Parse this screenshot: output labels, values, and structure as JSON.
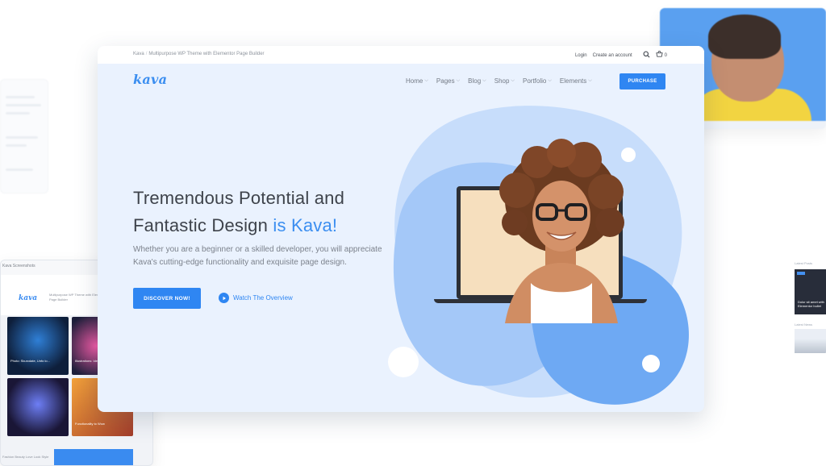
{
  "window": {
    "breadcrumb": {
      "site": "Kava",
      "separator": "/",
      "page": "Multipurpose WP Theme with Elementor Page Builder"
    },
    "topbar": {
      "login": "Login",
      "create_account": "Create an account",
      "cart_count": "0"
    },
    "logo": "kava",
    "menu": [
      {
        "label": "Home"
      },
      {
        "label": "Pages"
      },
      {
        "label": "Blog"
      },
      {
        "label": "Shop"
      },
      {
        "label": "Portfolio"
      },
      {
        "label": "Elements"
      }
    ],
    "purchase_label": "PURCHASE",
    "hero": {
      "title_line1": "Tremendous Potential and",
      "title_line2_prefix": "Fantastic Design ",
      "title_line2_accent": "is Kava!",
      "subtitle": "Whether you are a beginner or a skilled developer, you will appreciate Kava's cutting-edge functionality and exquisite page design.",
      "discover_label": "DISCOVER NOW!",
      "watch_label": "Watch The Overview"
    }
  },
  "background_cards": {
    "left_bottom": {
      "title": "Kava Screenshots",
      "logo": "kava",
      "text": "Multipurpose WP Theme with Elementor Page Builder",
      "captions": [
        "Photo: Skurcdate, Unfo lo...",
        "Illustrations: Ideas to...",
        "Functionality to Wow"
      ],
      "footer": "Fashion  Beauty  Love  Look  Style"
    },
    "right_mid": {
      "label_top": "Latest Posts",
      "label_bottom": "Latest News",
      "caption": "Dolor sit amet with Elementor bullet"
    }
  },
  "colors": {
    "accent": "#2f86f2",
    "hero_bg": "#eaf2fe",
    "blob_light": "#bcd7fb",
    "blob_mid": "#9cc3f8",
    "blob_dark": "#6aa6f2"
  }
}
